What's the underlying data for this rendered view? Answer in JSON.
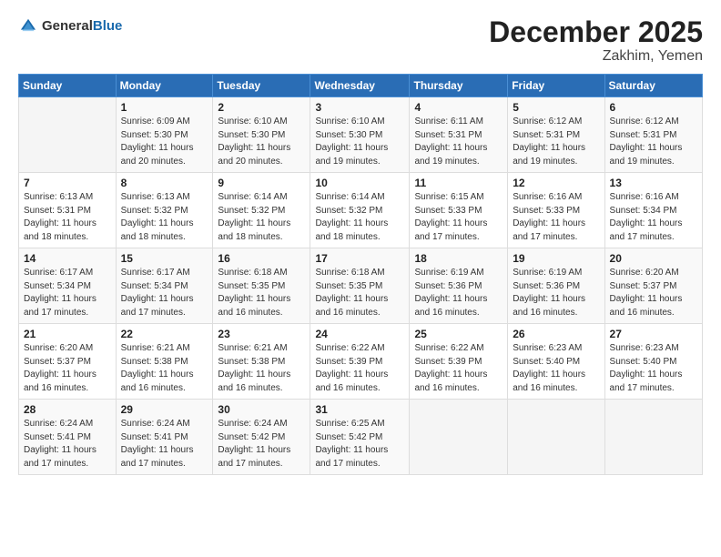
{
  "header": {
    "logo_general": "General",
    "logo_blue": "Blue",
    "month": "December 2025",
    "location": "Zakhim, Yemen"
  },
  "days_of_week": [
    "Sunday",
    "Monday",
    "Tuesday",
    "Wednesday",
    "Thursday",
    "Friday",
    "Saturday"
  ],
  "weeks": [
    [
      {
        "day": "",
        "info": ""
      },
      {
        "day": "1",
        "info": "Sunrise: 6:09 AM\nSunset: 5:30 PM\nDaylight: 11 hours\nand 20 minutes."
      },
      {
        "day": "2",
        "info": "Sunrise: 6:10 AM\nSunset: 5:30 PM\nDaylight: 11 hours\nand 20 minutes."
      },
      {
        "day": "3",
        "info": "Sunrise: 6:10 AM\nSunset: 5:30 PM\nDaylight: 11 hours\nand 19 minutes."
      },
      {
        "day": "4",
        "info": "Sunrise: 6:11 AM\nSunset: 5:31 PM\nDaylight: 11 hours\nand 19 minutes."
      },
      {
        "day": "5",
        "info": "Sunrise: 6:12 AM\nSunset: 5:31 PM\nDaylight: 11 hours\nand 19 minutes."
      },
      {
        "day": "6",
        "info": "Sunrise: 6:12 AM\nSunset: 5:31 PM\nDaylight: 11 hours\nand 19 minutes."
      }
    ],
    [
      {
        "day": "7",
        "info": "Sunrise: 6:13 AM\nSunset: 5:31 PM\nDaylight: 11 hours\nand 18 minutes."
      },
      {
        "day": "8",
        "info": "Sunrise: 6:13 AM\nSunset: 5:32 PM\nDaylight: 11 hours\nand 18 minutes."
      },
      {
        "day": "9",
        "info": "Sunrise: 6:14 AM\nSunset: 5:32 PM\nDaylight: 11 hours\nand 18 minutes."
      },
      {
        "day": "10",
        "info": "Sunrise: 6:14 AM\nSunset: 5:32 PM\nDaylight: 11 hours\nand 18 minutes."
      },
      {
        "day": "11",
        "info": "Sunrise: 6:15 AM\nSunset: 5:33 PM\nDaylight: 11 hours\nand 17 minutes."
      },
      {
        "day": "12",
        "info": "Sunrise: 6:16 AM\nSunset: 5:33 PM\nDaylight: 11 hours\nand 17 minutes."
      },
      {
        "day": "13",
        "info": "Sunrise: 6:16 AM\nSunset: 5:34 PM\nDaylight: 11 hours\nand 17 minutes."
      }
    ],
    [
      {
        "day": "14",
        "info": "Sunrise: 6:17 AM\nSunset: 5:34 PM\nDaylight: 11 hours\nand 17 minutes."
      },
      {
        "day": "15",
        "info": "Sunrise: 6:17 AM\nSunset: 5:34 PM\nDaylight: 11 hours\nand 17 minutes."
      },
      {
        "day": "16",
        "info": "Sunrise: 6:18 AM\nSunset: 5:35 PM\nDaylight: 11 hours\nand 16 minutes."
      },
      {
        "day": "17",
        "info": "Sunrise: 6:18 AM\nSunset: 5:35 PM\nDaylight: 11 hours\nand 16 minutes."
      },
      {
        "day": "18",
        "info": "Sunrise: 6:19 AM\nSunset: 5:36 PM\nDaylight: 11 hours\nand 16 minutes."
      },
      {
        "day": "19",
        "info": "Sunrise: 6:19 AM\nSunset: 5:36 PM\nDaylight: 11 hours\nand 16 minutes."
      },
      {
        "day": "20",
        "info": "Sunrise: 6:20 AM\nSunset: 5:37 PM\nDaylight: 11 hours\nand 16 minutes."
      }
    ],
    [
      {
        "day": "21",
        "info": "Sunrise: 6:20 AM\nSunset: 5:37 PM\nDaylight: 11 hours\nand 16 minutes."
      },
      {
        "day": "22",
        "info": "Sunrise: 6:21 AM\nSunset: 5:38 PM\nDaylight: 11 hours\nand 16 minutes."
      },
      {
        "day": "23",
        "info": "Sunrise: 6:21 AM\nSunset: 5:38 PM\nDaylight: 11 hours\nand 16 minutes."
      },
      {
        "day": "24",
        "info": "Sunrise: 6:22 AM\nSunset: 5:39 PM\nDaylight: 11 hours\nand 16 minutes."
      },
      {
        "day": "25",
        "info": "Sunrise: 6:22 AM\nSunset: 5:39 PM\nDaylight: 11 hours\nand 16 minutes."
      },
      {
        "day": "26",
        "info": "Sunrise: 6:23 AM\nSunset: 5:40 PM\nDaylight: 11 hours\nand 16 minutes."
      },
      {
        "day": "27",
        "info": "Sunrise: 6:23 AM\nSunset: 5:40 PM\nDaylight: 11 hours\nand 17 minutes."
      }
    ],
    [
      {
        "day": "28",
        "info": "Sunrise: 6:24 AM\nSunset: 5:41 PM\nDaylight: 11 hours\nand 17 minutes."
      },
      {
        "day": "29",
        "info": "Sunrise: 6:24 AM\nSunset: 5:41 PM\nDaylight: 11 hours\nand 17 minutes."
      },
      {
        "day": "30",
        "info": "Sunrise: 6:24 AM\nSunset: 5:42 PM\nDaylight: 11 hours\nand 17 minutes."
      },
      {
        "day": "31",
        "info": "Sunrise: 6:25 AM\nSunset: 5:42 PM\nDaylight: 11 hours\nand 17 minutes."
      },
      {
        "day": "",
        "info": ""
      },
      {
        "day": "",
        "info": ""
      },
      {
        "day": "",
        "info": ""
      }
    ]
  ]
}
